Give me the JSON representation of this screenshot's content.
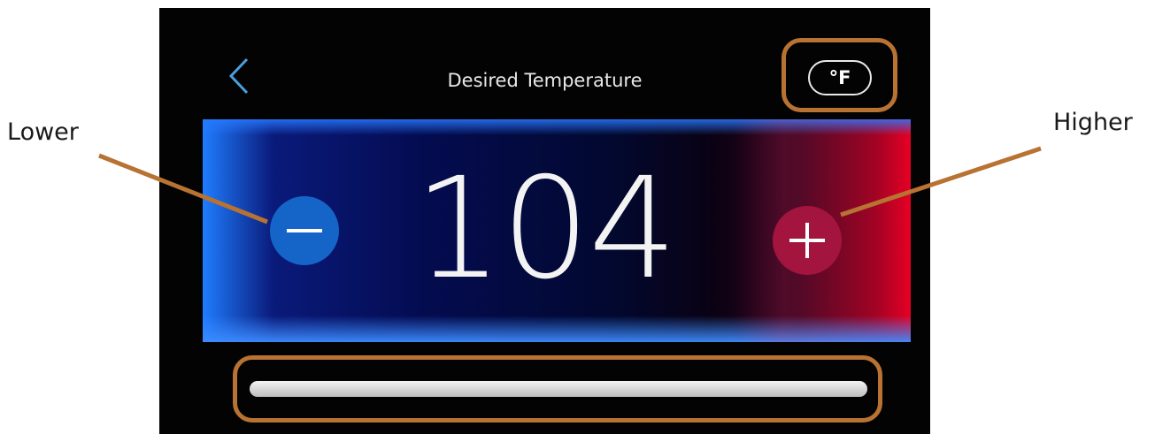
{
  "header": {
    "title": "Desired Temperature",
    "unit_label": "°F"
  },
  "temperature": {
    "value": "104"
  },
  "callouts": {
    "lower": "Lower",
    "higher": "Higher"
  },
  "colors": {
    "outline": "#b87232",
    "minus_button": "#1565c9",
    "plus_button": "#a3143f",
    "back_arrow": "#4a9fe0"
  },
  "icons": {
    "back": "chevron-left-icon",
    "minus": "minus-icon",
    "plus": "plus-icon"
  }
}
